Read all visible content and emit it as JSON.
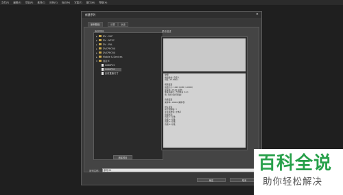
{
  "menu": [
    "文件(F)",
    "编辑(E)",
    "项目(P)",
    "素材(C)",
    "序列(S)",
    "标记(M)",
    "字幕(T)",
    "窗口(W)",
    "帮助(H)"
  ],
  "dialog": {
    "title": "新建序列",
    "close_glyph": "×",
    "tabs": [
      "序列预设",
      "设置",
      "轨道"
    ],
    "available_presets_label": "有效预设",
    "preset_description_label": "预设描述",
    "tree": [
      {
        "label": "DV - 24P",
        "kind": "folder",
        "arrow": "▶"
      },
      {
        "label": "DV - NTSC",
        "kind": "folder",
        "arrow": "▶"
      },
      {
        "label": "DV - PAL",
        "kind": "folder",
        "arrow": "▶"
      },
      {
        "label": "DVCPRO50",
        "kind": "folder",
        "arrow": "▶"
      },
      {
        "label": "DVCPRO50",
        "kind": "folder",
        "arrow": "▶"
      },
      {
        "label": "Mobile & Devices",
        "kind": "folder",
        "arrow": "▶"
      },
      {
        "label": "自定义",
        "kind": "folder",
        "arrow": "▼"
      },
      {
        "label": "1080P25",
        "kind": "file"
      },
      {
        "label": "1080P30",
        "kind": "file"
      },
      {
        "label": "目前直播尺寸",
        "kind": "file"
      }
    ],
    "description_lines": [
      "常规",
      "编辑模式: 自定义",
      "时基: 25.00fps",
      "",
      "视频设置",
      "画面大小: 1920 1080 (1.0000)",
      "帧速率: 25.00 帧/秒",
      "像素纵横比: 方形像素 (1.0)",
      "场: 无场 (逐行扫描)",
      "",
      "音频设置",
      "采样率: 48000 采样/秒",
      "",
      "默认序列",
      "总计视频轨: 3",
      "主音轨类型: 立体声",
      "音频轨道:",
      "音频 1: 标准",
      "音频 2: 标准",
      "音频 3: 标准",
      "音频 4: 标准"
    ],
    "delete_preset_label": "删除预设",
    "sequence_name_label": "序列名称:",
    "sequence_name_value": "序列 01",
    "ok_label": "确定",
    "cancel_label": "取消"
  },
  "watermark": {
    "main": "百科全说",
    "sub": "助你轻松解决"
  }
}
